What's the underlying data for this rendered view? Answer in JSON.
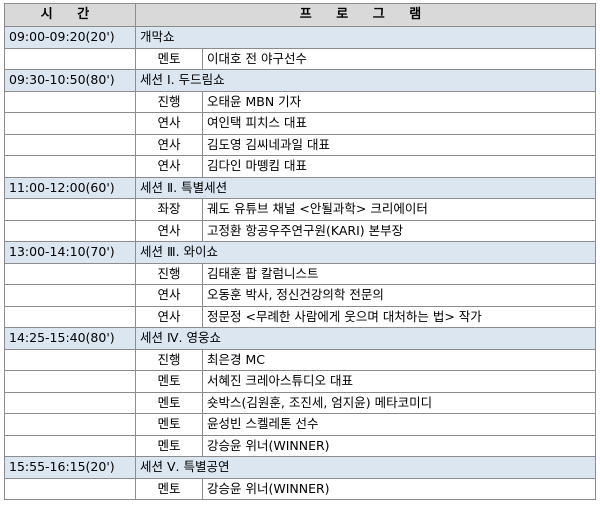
{
  "header": {
    "time": "시  간",
    "program": "프 로 그 램"
  },
  "sections": [
    {
      "time": "09:00-09:20(20')",
      "title": "개막쇼",
      "rows": [
        {
          "role": "멘토",
          "desc": "이대호 전 야구선수"
        }
      ]
    },
    {
      "time": "09:30-10:50(80')",
      "title": "세션 Ⅰ. 두드림쇼",
      "rows": [
        {
          "role": "진행",
          "desc": "오태윤 MBN 기자"
        },
        {
          "role": "연사",
          "desc": "여인택 피치스 대표"
        },
        {
          "role": "연사",
          "desc": "김도영 김씨네과일 대표"
        },
        {
          "role": "연사",
          "desc": "김다인 마뗑킴 대표"
        }
      ]
    },
    {
      "time": "11:00-12:00(60')",
      "title": "세션 Ⅱ. 특별세션",
      "rows": [
        {
          "role": "좌장",
          "desc": "궤도 유튜브 채널 <안될과학> 크리에이터"
        },
        {
          "role": "연사",
          "desc": "고정환 항공우주연구원(KARI) 본부장"
        }
      ]
    },
    {
      "time": "13:00-14:10(70')",
      "title": "세션 Ⅲ. 와이쇼",
      "rows": [
        {
          "role": "진행",
          "desc": "김태훈 팝 칼럼니스트"
        },
        {
          "role": "연사",
          "desc": "오동훈 박사, 정신건강의학 전문의"
        },
        {
          "role": "연사",
          "desc": "정문정 <무례한 사람에게 웃으며 대처하는 법> 작가"
        }
      ]
    },
    {
      "time": "14:25-15:40(80')",
      "title": "세션 Ⅳ. 영웅쇼",
      "rows": [
        {
          "role": "진행",
          "desc": "최은경 MC"
        },
        {
          "role": "멘토",
          "desc": "서혜진 크레아스튜디오 대표"
        },
        {
          "role": "멘토",
          "desc": "숏박스(김원훈, 조진세, 엄지윤) 메타코미디"
        },
        {
          "role": "멘토",
          "desc": "윤성빈 스켈레톤 선수"
        },
        {
          "role": "멘토",
          "desc": "강승윤 위너(WINNER)"
        }
      ]
    },
    {
      "time": "15:55-16:15(20')",
      "title": "세션 Ⅴ. 특별공연",
      "rows": [
        {
          "role": "멘토",
          "desc": "강승윤 위너(WINNER)"
        }
      ]
    }
  ]
}
